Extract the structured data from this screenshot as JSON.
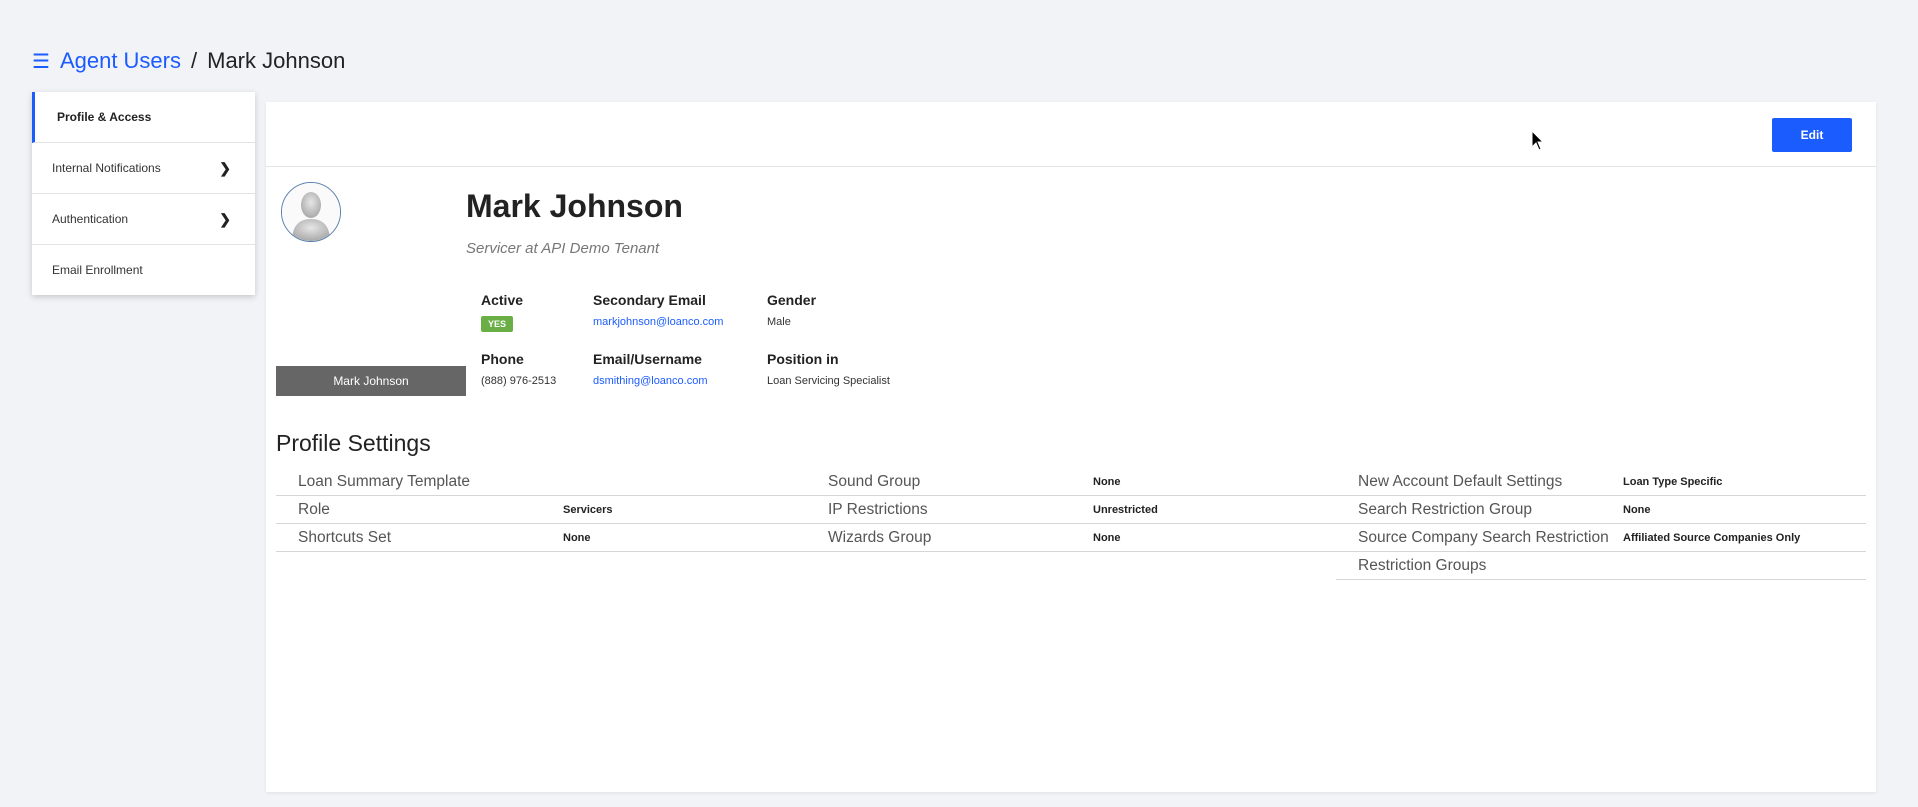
{
  "breadcrumb": {
    "parent": "Agent Users",
    "separator": "/",
    "current": "Mark Johnson"
  },
  "sidebar": {
    "items": [
      {
        "label": "Profile & Access"
      },
      {
        "label": "Internal Notifications"
      },
      {
        "label": "Authentication"
      },
      {
        "label": "Email Enrollment"
      }
    ]
  },
  "toolbar": {
    "edit_label": "Edit"
  },
  "profile": {
    "name": "Mark Johnson",
    "subtitle": "Servicer at API Demo Tenant",
    "avatar_caption": "Mark Johnson",
    "fields": {
      "active": {
        "label": "Active",
        "value": "YES"
      },
      "secondary_email": {
        "label": "Secondary Email",
        "value": "markjohnson@loanco.com"
      },
      "gender": {
        "label": "Gender",
        "value": "Male"
      },
      "phone": {
        "label": "Phone",
        "value": "(888) 976-2513"
      },
      "email_username": {
        "label": "Email/Username",
        "value": "dsmithing@loanco.com"
      },
      "position": {
        "label": "Position in",
        "value": "Loan Servicing Specialist"
      }
    }
  },
  "settings": {
    "title": "Profile Settings",
    "col1": [
      {
        "label": "Loan Summary Template",
        "value": ""
      },
      {
        "label": "Role",
        "value": "Servicers"
      },
      {
        "label": "Shortcuts Set",
        "value": "None"
      }
    ],
    "col2": [
      {
        "label": "Sound Group",
        "value": "None"
      },
      {
        "label": "IP Restrictions",
        "value": "Unrestricted"
      },
      {
        "label": "Wizards Group",
        "value": "None"
      }
    ],
    "col3": [
      {
        "label": "New Account Default Settings",
        "value": "Loan Type Specific"
      },
      {
        "label": "Search Restriction Group",
        "value": "None"
      },
      {
        "label": "Source Company Search Restriction",
        "value": "Affiliated Source Companies Only"
      },
      {
        "label": "Restriction Groups",
        "value": ""
      }
    ]
  },
  "colors": {
    "accent": "#1b5cff",
    "active_badge": "#6aaf45",
    "avatar_caption_bg": "#666666"
  }
}
